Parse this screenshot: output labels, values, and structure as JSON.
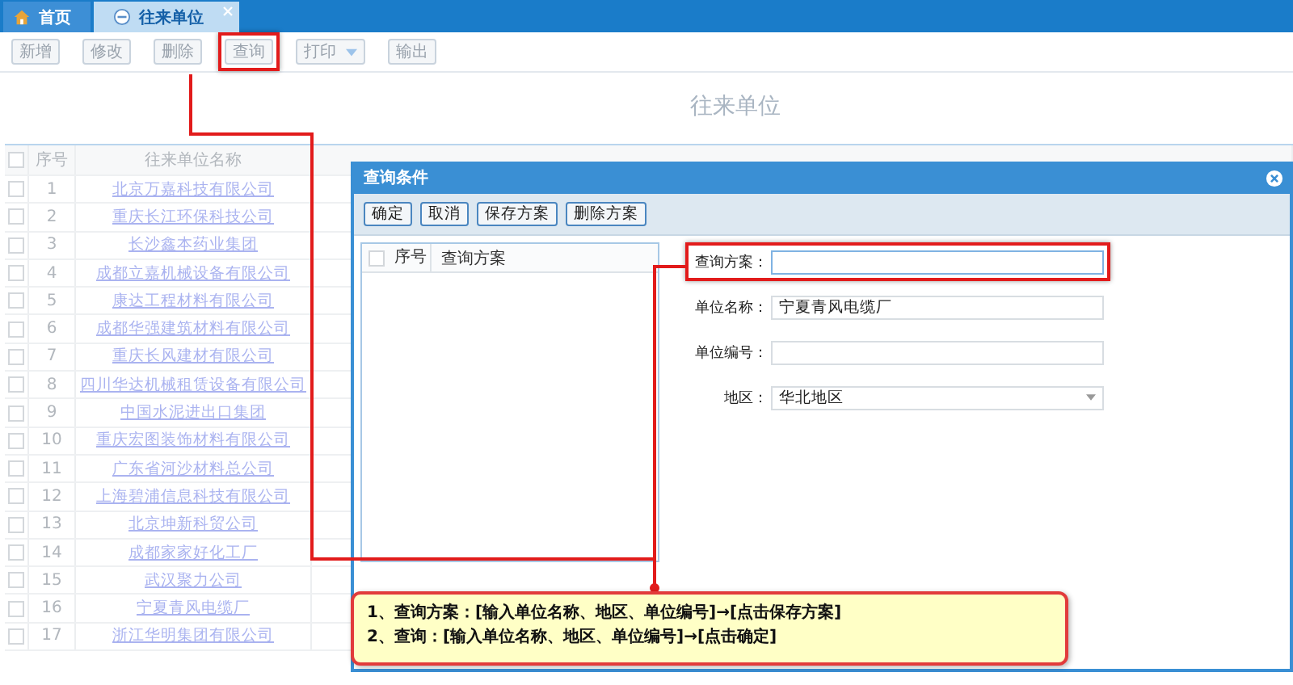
{
  "tabs": [
    {
      "label": "首页",
      "kind": "home",
      "selected": false,
      "closable": false
    },
    {
      "label": "往来单位",
      "kind": "page",
      "selected": true,
      "closable": true
    }
  ],
  "toolbar": [
    {
      "label": "新增",
      "kind": "button",
      "highlighted": false
    },
    {
      "label": "修改",
      "kind": "button",
      "highlighted": false
    },
    {
      "label": "删除",
      "kind": "button",
      "highlighted": false
    },
    {
      "label": "查询",
      "kind": "button",
      "highlighted": true
    },
    {
      "label": "打印",
      "kind": "dropdown",
      "highlighted": false
    },
    {
      "label": "输出",
      "kind": "button",
      "highlighted": false
    }
  ],
  "page_title": "往来单位",
  "table": {
    "columns": [
      "序号",
      "往来单位名称"
    ],
    "all_checked": false,
    "rows": [
      {
        "no": "1",
        "name": "北京万嘉科技有限公司",
        "checked": false
      },
      {
        "no": "2",
        "name": "重庆长江环保科技公司",
        "checked": false
      },
      {
        "no": "3",
        "name": "长沙鑫本药业集团",
        "checked": false
      },
      {
        "no": "4",
        "name": "成都立嘉机械设备有限公司",
        "checked": false
      },
      {
        "no": "5",
        "name": "康达工程材料有限公司",
        "checked": false
      },
      {
        "no": "6",
        "name": "成都华强建筑材料有限公司",
        "checked": false
      },
      {
        "no": "7",
        "name": "重庆长风建材有限公司",
        "checked": false
      },
      {
        "no": "8",
        "name": "四川华达机械租赁设备有限公司",
        "checked": false
      },
      {
        "no": "9",
        "name": "中国水泥进出口集团",
        "checked": false
      },
      {
        "no": "10",
        "name": "重庆宏图装饰材料有限公司",
        "checked": false
      },
      {
        "no": "11",
        "name": "广东省河沙材料总公司",
        "checked": false
      },
      {
        "no": "12",
        "name": "上海碧浦信息科技有限公司",
        "checked": false
      },
      {
        "no": "13",
        "name": "北京坤新科贸公司",
        "checked": false
      },
      {
        "no": "14",
        "name": "成都家家好化工厂",
        "checked": false
      },
      {
        "no": "15",
        "name": "武汉聚力公司",
        "checked": false
      },
      {
        "no": "16",
        "name": "宁夏青风电缆厂",
        "checked": false
      },
      {
        "no": "17",
        "name": "浙江华明集团有限公司",
        "checked": false
      }
    ]
  },
  "dialog": {
    "title": "查询条件",
    "buttons": [
      "确定",
      "取消",
      "保存方案",
      "删除方案"
    ],
    "list": {
      "columns": [
        "序号",
        "查询方案"
      ],
      "all_checked": false
    },
    "fields": [
      {
        "label": "查询方案：",
        "kind": "text",
        "highlighted": true
      },
      {
        "label": "单位名称：",
        "kind": "text",
        "value": "宁夏青风电缆厂",
        "highlighted": false
      },
      {
        "label": "单位编号：",
        "kind": "text",
        "highlighted": false
      },
      {
        "label": "地区：",
        "kind": "select",
        "value": "华北地区",
        "highlighted": false
      }
    ]
  },
  "callout": [
    "1、查询方案：[输入单位名称、地区、单位编号]→[点击保存方案]",
    "2、查询：[输入单位名称、地区、单位编号]→[点击确定]"
  ]
}
